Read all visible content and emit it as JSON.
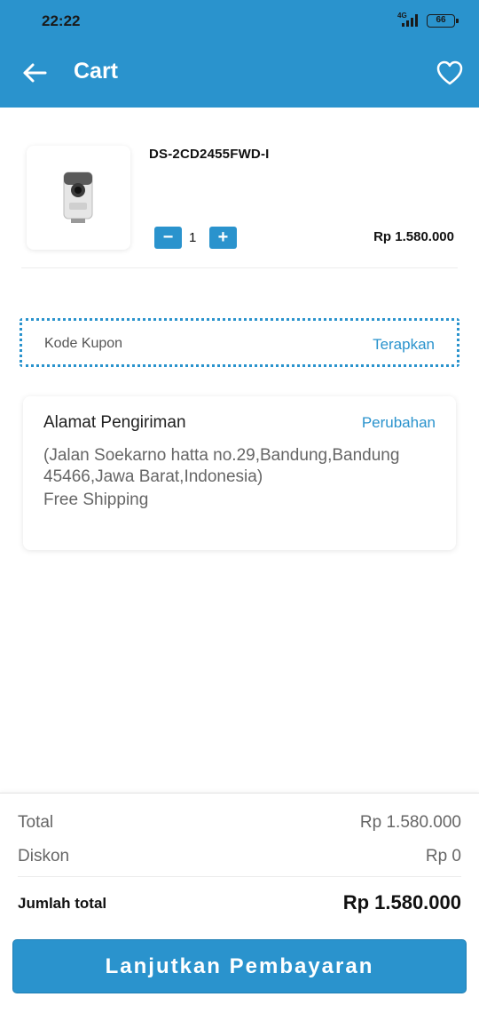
{
  "status_bar": {
    "time": "22:22",
    "network": "4G",
    "battery": "66"
  },
  "header": {
    "title": "Cart",
    "back_icon": "arrow-left-icon",
    "favorite_icon": "heart-outline-icon",
    "background": "#2a93cd"
  },
  "cart_item": {
    "image_icon": "cctv-camera-icon",
    "name": "DS-2CD2455FWD-I",
    "quantity": "1",
    "minus_label": "−",
    "plus_label": "+",
    "price": "Rp 1.580.000"
  },
  "coupon": {
    "placeholder": "Kode Kupon",
    "apply_label": "Terapkan"
  },
  "address": {
    "title": "Alamat Pengiriman",
    "change_label": "Perubahan",
    "text": "(Jalan Soekarno hatta no.29,Bandung,Bandung 45466,Jawa Barat,Indonesia)",
    "shipping": "Free Shipping"
  },
  "summary": {
    "total_label": "Total",
    "total_value": "Rp 1.580.000",
    "discount_label": "Diskon",
    "discount_value": "Rp 0",
    "grand_label": "Jumlah total",
    "grand_value": "Rp 1.580.000",
    "pay_button": "Lanjutkan Pembayaran"
  }
}
